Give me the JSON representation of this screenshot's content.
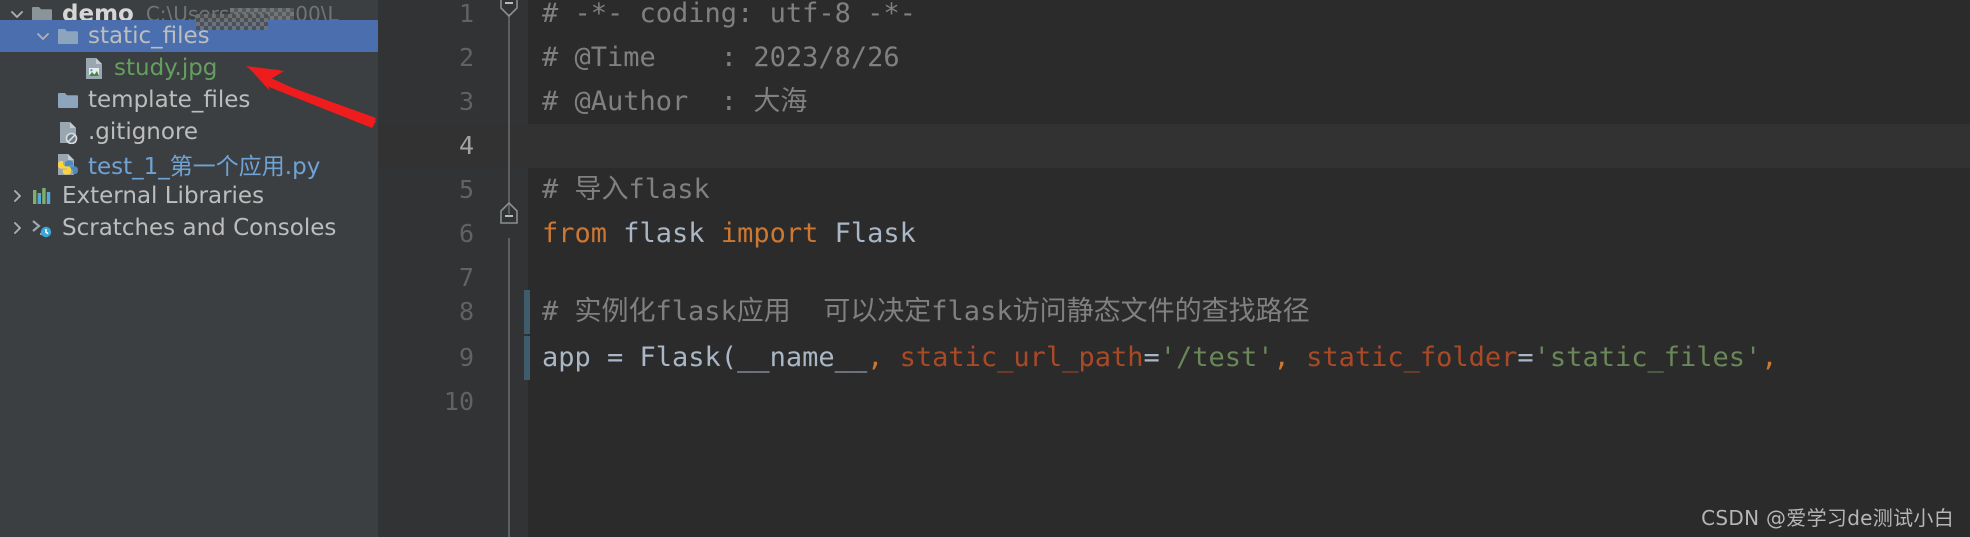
{
  "project_tree": {
    "items": [
      {
        "id": "demo",
        "label": "demo",
        "path": "C:\\Users",
        "path_tail": "00\\L",
        "icon": "folder-module-icon",
        "arrow": "chevron-down-icon",
        "indent": 0,
        "selected": false,
        "style": "bold",
        "redacted": true
      },
      {
        "id": "static_files",
        "label": "static_files",
        "icon": "folder-icon",
        "arrow": "chevron-down-icon",
        "indent": 1,
        "selected": true,
        "style": "plain"
      },
      {
        "id": "study-jpg",
        "label": "study.jpg",
        "icon": "image-file-icon",
        "arrow": "none",
        "indent": 2,
        "selected": false,
        "style": "image"
      },
      {
        "id": "template_files",
        "label": "template_files",
        "icon": "folder-icon",
        "arrow": "none",
        "indent": 1,
        "selected": false,
        "style": "plain"
      },
      {
        "id": "gitignore",
        "label": ".gitignore",
        "icon": "gitignore-file-icon",
        "arrow": "none",
        "indent": 1,
        "selected": false,
        "style": "plain"
      },
      {
        "id": "test_1_py",
        "label": "test_1_第一个应用.py",
        "icon": "python-file-icon",
        "arrow": "none",
        "indent": 1,
        "selected": false,
        "style": "python"
      },
      {
        "id": "external_libraries",
        "label": "External Libraries",
        "icon": "libraries-icon",
        "arrow": "chevron-right-icon",
        "indent": 0,
        "selected": false,
        "style": "plain"
      },
      {
        "id": "scratches",
        "label": "Scratches and Consoles",
        "icon": "scratches-icon",
        "arrow": "chevron-right-icon",
        "indent": 0,
        "selected": false,
        "style": "plain"
      }
    ]
  },
  "editor": {
    "lines": [
      {
        "number": "1",
        "fold": "fold-end",
        "current": false,
        "changed": false,
        "tokens": [
          {
            "t": "# -*- coding: utf-8 -*-",
            "c": "cmt"
          }
        ]
      },
      {
        "number": "2",
        "fold": "none",
        "current": false,
        "changed": false,
        "tokens": [
          {
            "t": "# @Time    : 2023/8/26",
            "c": "cmt"
          }
        ]
      },
      {
        "number": "3",
        "fold": "none",
        "current": false,
        "changed": false,
        "tokens": [
          {
            "t": "# @Author  : 大海",
            "c": "cmt"
          }
        ]
      },
      {
        "number": "4",
        "fold": "none",
        "current": true,
        "changed": false,
        "tokens": []
      },
      {
        "number": "5",
        "fold": "fold-start",
        "current": false,
        "changed": false,
        "tokens": [
          {
            "t": "# 导入flask",
            "c": "cmt"
          }
        ]
      },
      {
        "number": "6",
        "fold": "none",
        "current": false,
        "changed": false,
        "tokens": [
          {
            "t": "from",
            "c": "kw"
          },
          {
            "t": " flask ",
            "c": "ident"
          },
          {
            "t": "import",
            "c": "kw"
          },
          {
            "t": " Flask",
            "c": "ident"
          }
        ]
      },
      {
        "number": "7",
        "fold": "none",
        "current": false,
        "changed": false,
        "tokens": []
      },
      {
        "number": "8",
        "fold": "none",
        "current": false,
        "changed": true,
        "tokens": [
          {
            "t": "# 实例化flask应用  可以决定flask访问静态文件的查找路径",
            "c": "cmt"
          }
        ]
      },
      {
        "number": "9",
        "fold": "none",
        "current": false,
        "changed": true,
        "tokens": [
          {
            "t": "app = Flask(__name__",
            "c": "ident"
          },
          {
            "t": ",",
            "c": "comma"
          },
          {
            "t": " ",
            "c": "ident"
          },
          {
            "t": "static_url_path",
            "c": "param"
          },
          {
            "t": "=",
            "c": "ident"
          },
          {
            "t": "'/test'",
            "c": "str"
          },
          {
            "t": ",",
            "c": "comma"
          },
          {
            "t": " ",
            "c": "ident"
          },
          {
            "t": "static_folder",
            "c": "param"
          },
          {
            "t": "=",
            "c": "ident"
          },
          {
            "t": "'static_files'",
            "c": "str"
          },
          {
            "t": ",",
            "c": "comma"
          }
        ]
      },
      {
        "number": "10",
        "fold": "none",
        "current": false,
        "changed": false,
        "tokens": []
      }
    ]
  },
  "annotation": {
    "arrow_name": "red-pointer-arrow",
    "arrow_color": "#ee1c1c",
    "points_at": "study.jpg"
  },
  "watermark": {
    "text": "CSDN @爱学习de测试小白"
  },
  "colors": {
    "editor_bg": "#2b2b2b",
    "gutter_bg": "#313335",
    "sidebar_bg": "#3c3f41",
    "selection_blue": "#4b6eaf",
    "comment_gray": "#808080",
    "keyword_orange": "#cc7832",
    "string_green": "#6a8759",
    "param_red": "#aa4926",
    "identifier": "#a9b7c6",
    "python_file_blue": "#6fa3d6",
    "image_file_green": "#63a05e"
  }
}
